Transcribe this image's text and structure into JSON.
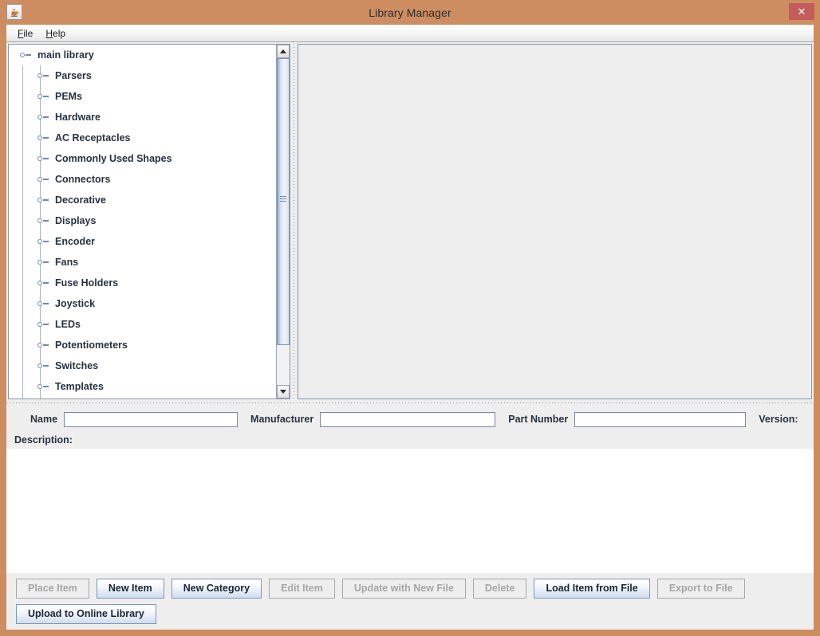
{
  "window": {
    "title": "Library Manager",
    "icon": "java-coffee-cup-icon",
    "close_label": "✕",
    "titlebar_color": "#cd8d60",
    "close_color": "#c45c5c"
  },
  "menubar": {
    "items": [
      {
        "label": "File",
        "mnemonic": "F"
      },
      {
        "label": "Help",
        "mnemonic": "H"
      }
    ]
  },
  "tree": {
    "root": {
      "label": "main library"
    },
    "children": [
      {
        "label": "Parsers"
      },
      {
        "label": "PEMs"
      },
      {
        "label": "Hardware"
      },
      {
        "label": "AC Receptacles"
      },
      {
        "label": "Commonly Used Shapes"
      },
      {
        "label": "Connectors"
      },
      {
        "label": "Decorative"
      },
      {
        "label": "Displays"
      },
      {
        "label": "Encoder"
      },
      {
        "label": "Fans"
      },
      {
        "label": "Fuse Holders"
      },
      {
        "label": "Joystick"
      },
      {
        "label": "LEDs"
      },
      {
        "label": "Potentiometers"
      },
      {
        "label": "Switches"
      },
      {
        "label": "Templates"
      }
    ]
  },
  "form": {
    "name_label": "Name",
    "name_value": "",
    "manufacturer_label": "Manufacturer",
    "manufacturer_value": "",
    "part_number_label": "Part Number",
    "part_number_value": "",
    "version_label": "Version:",
    "description_label": "Description:",
    "description_value": ""
  },
  "buttons": {
    "row1": [
      {
        "label": "Place Item",
        "enabled": false
      },
      {
        "label": "New Item",
        "enabled": true
      },
      {
        "label": "New Category",
        "enabled": true
      },
      {
        "label": "Edit Item",
        "enabled": false
      },
      {
        "label": "Update with New File",
        "enabled": false
      },
      {
        "label": "Delete",
        "enabled": false
      },
      {
        "label": "Load Item from File",
        "enabled": true
      },
      {
        "label": "Export to File",
        "enabled": false
      }
    ],
    "row2": [
      {
        "label": "Upload to Online Library",
        "enabled": true
      }
    ]
  }
}
